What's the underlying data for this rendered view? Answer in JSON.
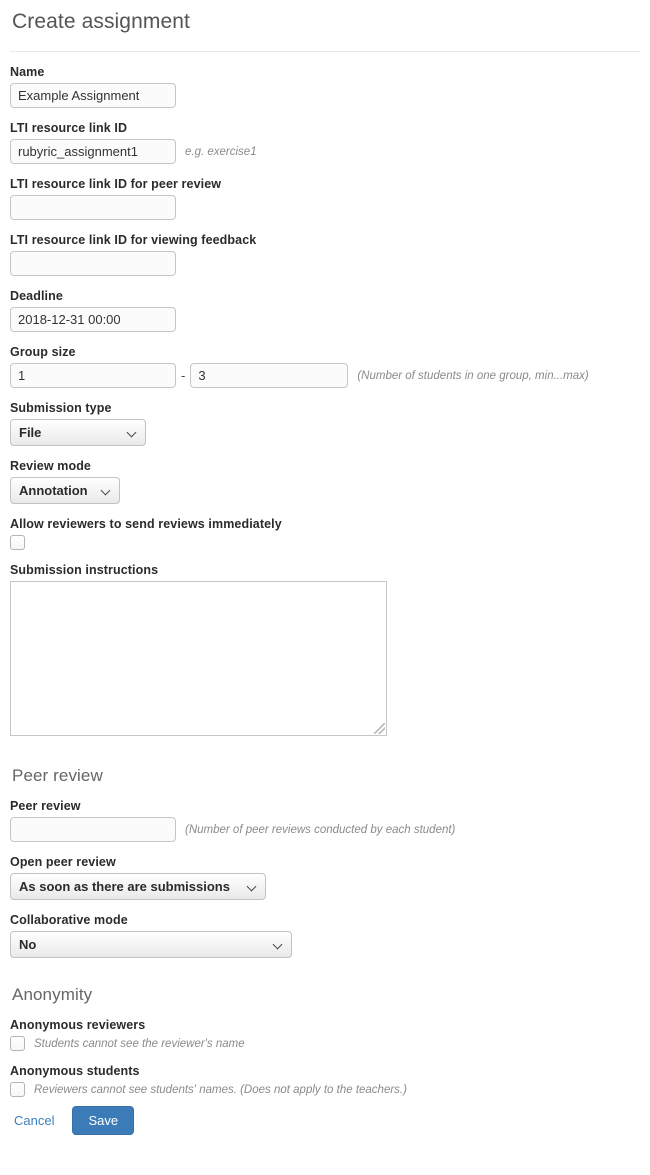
{
  "page": {
    "title": "Create assignment"
  },
  "fields": {
    "name": {
      "label": "Name",
      "value": "Example Assignment",
      "placeholder": ""
    },
    "lti_resource_link_id": {
      "label": "LTI resource link ID",
      "value": "rubyric_assignment1",
      "placeholder": "",
      "hint": "e.g. exercise1"
    },
    "lti_resource_link_id_peer_review": {
      "label": "LTI resource link ID for peer review",
      "value": "",
      "placeholder": ""
    },
    "lti_resource_link_id_viewing_feedback": {
      "label": "LTI resource link ID for viewing feedback",
      "value": "",
      "placeholder": ""
    },
    "deadline": {
      "label": "Deadline",
      "value": "2018-12-31 00:00",
      "placeholder": ""
    },
    "group_size": {
      "label": "Group size",
      "min_value": "1",
      "max_value": "3",
      "separator": "-",
      "hint": "(Number of students in one group, min...max)"
    },
    "submission_type": {
      "label": "Submission type",
      "selected": "File"
    },
    "review_mode": {
      "label": "Review mode",
      "selected": "Annotation"
    },
    "allow_immediate_reviews": {
      "label": "Allow reviewers to send reviews immediately",
      "checked": false
    },
    "submission_instructions": {
      "label": "Submission instructions",
      "value": "",
      "placeholder": ""
    }
  },
  "peer_review_section": {
    "title": "Peer review",
    "peer_review": {
      "label": "Peer review",
      "value": "",
      "placeholder": "",
      "hint": "(Number of peer reviews conducted by each student)"
    },
    "open_peer_review": {
      "label": "Open peer review",
      "selected": "As soon as there are submissions"
    },
    "collaborative_mode": {
      "label": "Collaborative mode",
      "selected": "No"
    }
  },
  "anonymity_section": {
    "title": "Anonymity",
    "anonymous_reviewers": {
      "label": "Anonymous reviewers",
      "note": "Students cannot see the reviewer's name",
      "checked": false
    },
    "anonymous_students": {
      "label": "Anonymous students",
      "note": "Reviewers cannot see students' names. (Does not apply to the teachers.)",
      "checked": false
    }
  },
  "actions": {
    "cancel_label": "Cancel",
    "save_label": "Save"
  },
  "colors": {
    "primary": "#3b7cb8",
    "link": "#3e7fc1",
    "label_text": "#2b2b2b",
    "hint_text": "#8a8a8a",
    "heading": "#666666"
  }
}
